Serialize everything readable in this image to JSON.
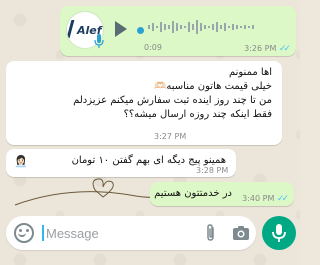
{
  "voice_message": {
    "logo_text": "Alef",
    "duration": "0:09",
    "time": "3:26 PM"
  },
  "messages": [
    {
      "lines": [
        "اها ممنونم",
        "خیلی قیمت هاتون مناسبه🫶🏻",
        "من تا چند روز اینده ثبت سفارش میکنم عزیزدلم",
        "فقط اینکه چند روزه ارسال میشه؟؟"
      ],
      "time": "3:27 PM"
    },
    {
      "text": "همینو پیج دیگه ای بهم گفتن ۱۰ تومان",
      "emoji": "👩🏻‍💼",
      "time": "3:28 PM"
    },
    {
      "text": "در خدمتتون هستیم",
      "time": "3:40 PM"
    }
  ],
  "input": {
    "placeholder": "Message"
  },
  "colors": {
    "outgoing": "#dcf8c6",
    "incoming": "#ffffff",
    "accent": "#00a884",
    "read_ticks": "#4fc3f7"
  }
}
